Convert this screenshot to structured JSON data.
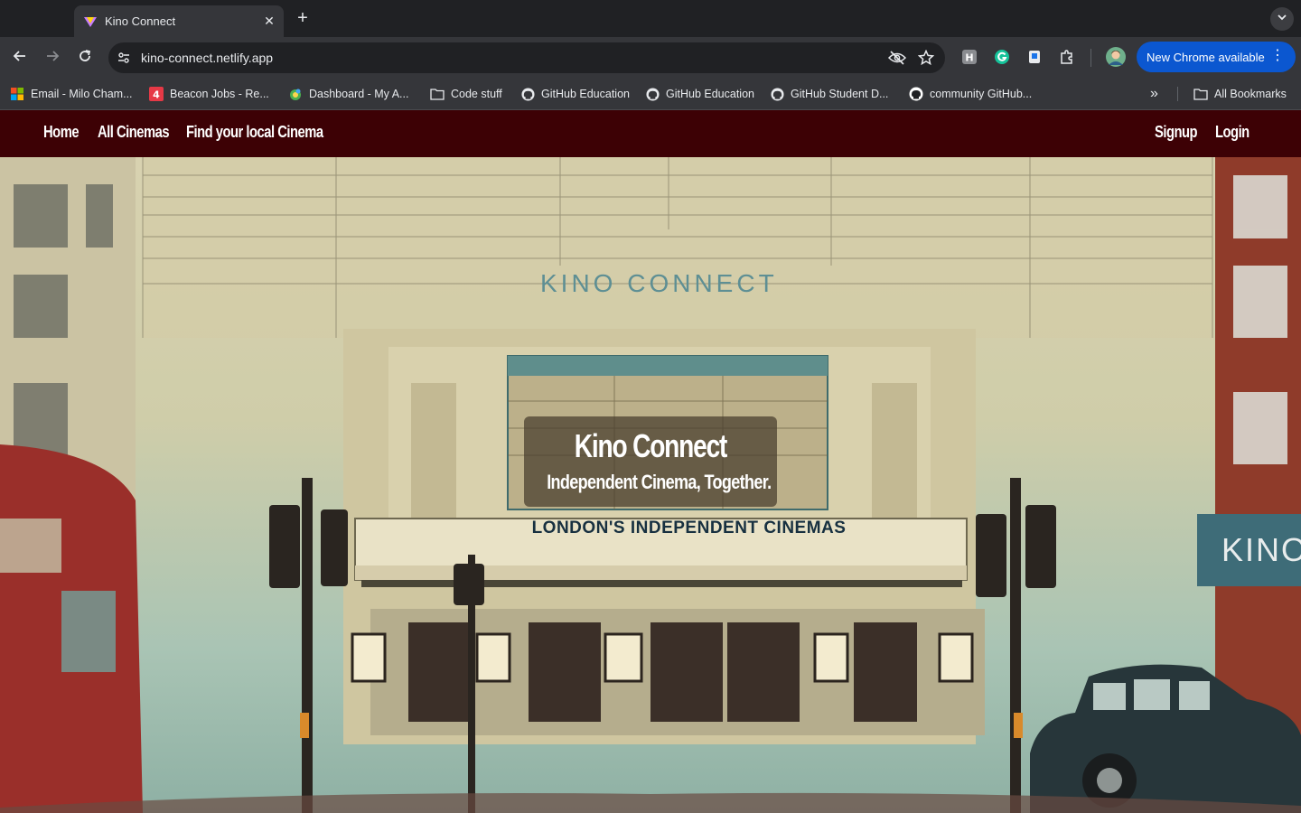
{
  "browser": {
    "tab": {
      "title": "Kino Connect",
      "close_glyph": "✕"
    },
    "new_tab_glyph": "+",
    "address": {
      "url": "kino-connect.netlify.app"
    },
    "update_button": {
      "label": "New Chrome available",
      "menu_glyph": "⋮"
    },
    "bookmarks": [
      {
        "label": "Email - Milo Cham...",
        "icon": "microsoft-icon"
      },
      {
        "label": "Beacon Jobs - Re...",
        "icon": "beacon-icon"
      },
      {
        "label": "Dashboard - My A...",
        "icon": "dashboard-icon"
      },
      {
        "label": "Code stuff",
        "icon": "folder-icon"
      },
      {
        "label": "GitHub Education",
        "icon": "github-icon"
      },
      {
        "label": "GitHub Education",
        "icon": "github-icon"
      },
      {
        "label": "GitHub Student D...",
        "icon": "github-icon"
      },
      {
        "label": "community GitHub...",
        "icon": "github-icon"
      }
    ],
    "bookmarks_overflow_glyph": "»",
    "all_bookmarks": "All Bookmarks"
  },
  "site": {
    "nav": {
      "home": "Home",
      "all_cinemas": "All Cinemas",
      "find_local": "Find your local Cinema",
      "signup": "Signup",
      "login": "Login"
    },
    "hero": {
      "title": "Kino Connect",
      "subtitle": "Independent Cinema, Together.",
      "facade_sign": "KINO CONNECT",
      "marquee": "LONDON'S INDEPENDENT CINEMAS",
      "side_sign": "KINO"
    }
  },
  "colors": {
    "nav_bg": "#3d0105",
    "update_button": "#0b57d0",
    "toolbar": "#35363a"
  }
}
